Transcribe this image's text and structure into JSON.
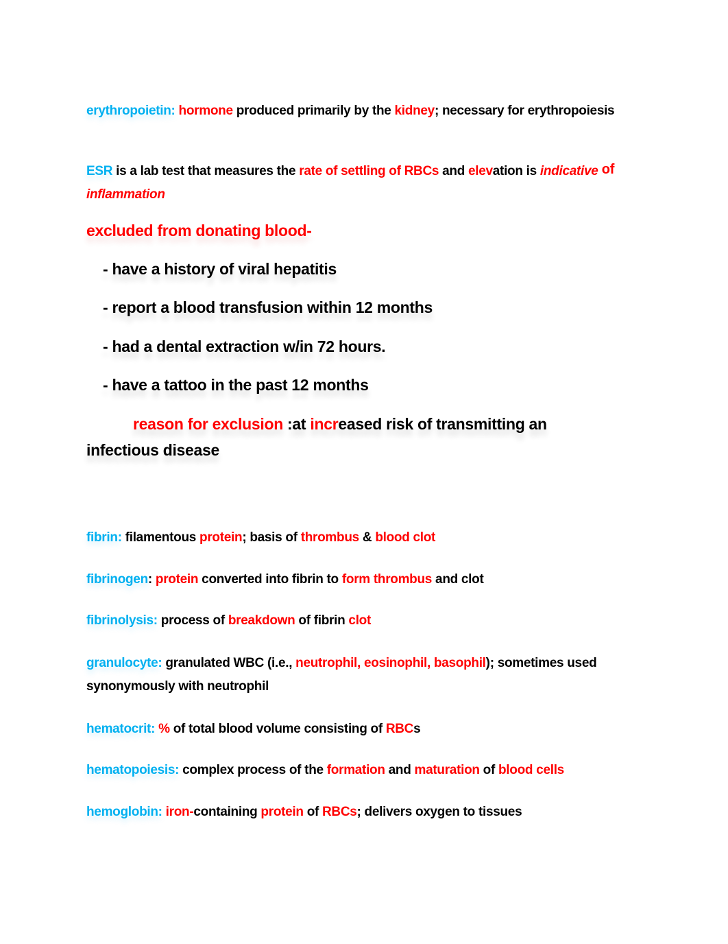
{
  "colors": {
    "term": "#00B0F0",
    "emphasis": "#FF0000",
    "text": "#000000"
  },
  "paragraphs": {
    "erythropoietin": {
      "term": "erythropoietin:",
      "s1": "hormone",
      "s2": " produced primarily by the ",
      "s3": "kidney",
      "s4": "; necessary for erythropoiesis"
    },
    "esr": {
      "term": "ESR",
      "s1": " is a lab test that measures the ",
      "s2": "rate of settling of RBCs",
      "s3": " and ",
      "s4": "elev",
      "s5": "ation is ",
      "s6": "indicative",
      "s7": " of ",
      "s8": "inflammation"
    },
    "excluded_heading": "excluded from donating blood-",
    "exclusions": [
      "- have a history of viral hepatitis",
      "- report a blood transfusion within 12 months",
      "- had a dental extraction w/in 72 hours.",
      "- have a tattoo in the past 12 months"
    ],
    "reason": {
      "label": "reason for exclusion",
      "s1": " :at ",
      "s2": "incr",
      "s3": "eased risk of transmitting an infectious disease"
    },
    "fibrin": {
      "term": "fibrin:",
      "s1": " filamentous ",
      "s2": "protein",
      "s3": "; basis of ",
      "s4": "thrombus",
      "s5": " & ",
      "s6": "blood clot"
    },
    "fibrinogen": {
      "term": "fibrinogen",
      "s0": ": ",
      "s1": "protein",
      "s2": " converted into fibrin to ",
      "s3": "form thrombus",
      "s4": " and clot"
    },
    "fibrinolysis": {
      "term": "fibrinolysis:",
      "s1": " process of ",
      "s2": "breakdown",
      "s3": " of fibrin ",
      "s4": "clot"
    },
    "granulocyte": {
      "term": "granulocyte:",
      "s1": " granulated WBC (i.e., ",
      "s2": "neutrophil, eosinophil, basophil",
      "s3": "); sometimes used synonymously with neutrophil"
    },
    "hematocrit": {
      "term": "hematocrit:",
      "s1": "%",
      "s2": " of total blood volume consisting of ",
      "s3": "RBC",
      "s4": "s"
    },
    "hematopoiesis": {
      "term": "hematopoiesis:",
      "s1": " complex process of the ",
      "s2": "formation",
      "s3": " and ",
      "s4": "maturation",
      "s5": " of ",
      "s6": "blood cells"
    },
    "hemoglobin": {
      "term": "hemoglobin:",
      "s1": "iron-",
      "s2": "containing ",
      "s3": "protein",
      "s4": " of ",
      "s5": "RBCs",
      "s6": "; delivers oxygen to tissues"
    }
  }
}
